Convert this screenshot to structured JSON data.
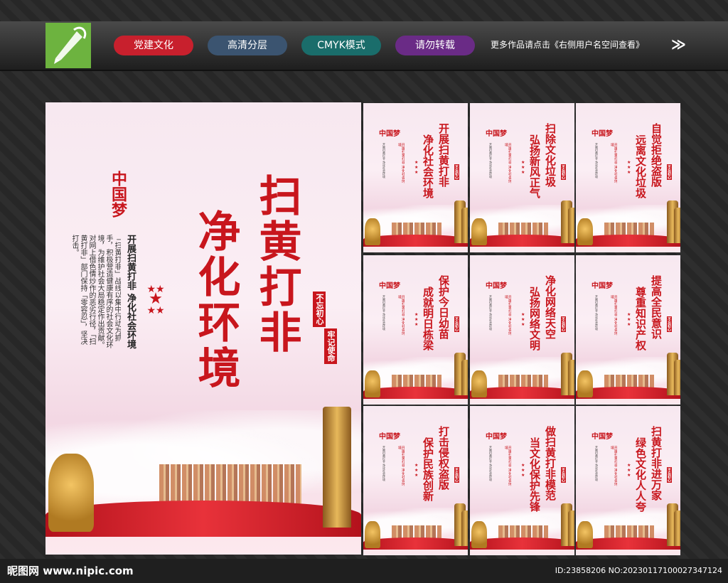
{
  "header": {
    "buttons": [
      {
        "label": "党建文化",
        "color": "#c8202d"
      },
      {
        "label": "高清分层",
        "color": "#3b5470"
      },
      {
        "label": "CMYK模式",
        "color": "#1a6d6b"
      },
      {
        "label": "请勿转载",
        "color": "#6a2b86"
      }
    ],
    "note": "更多作品请点击《右侧用户名空间查看》",
    "arrow": "≫"
  },
  "main_poster": {
    "title_a": "扫黄打非",
    "title_b": "净化环境",
    "subtitle": "开展扫黄打非 净化社会环境",
    "logo": "中国梦",
    "body": "「扫黄打非」战线以集中行动为抓手，积极营造健康有序的社会文化环境，为维护社会大局稳定作出贡献。对网上借色情炒作的恶劣行径，「扫黄打非」部门保持「零容忍」，坚决打击。",
    "slogan_a": "不忘初心",
    "slogan_b": "牢记使命"
  },
  "small_posters": [
    {
      "line1": "开展扫黄打非",
      "line2": "净化社会环境"
    },
    {
      "line1": "扫除文化垃圾",
      "line2": "弘扬新风正气"
    },
    {
      "line1": "自觉拒绝盗版",
      "line2": "远离文化垃圾"
    },
    {
      "line1": "保护今日幼苗",
      "line2": "成就明日栋梁"
    },
    {
      "line1": "净化网络天空",
      "line2": "弘扬网络文明"
    },
    {
      "line1": "提高全民意识",
      "line2": "尊重知识产权"
    },
    {
      "line1": "打击侵权盗版",
      "line2": "保护民族创新"
    },
    {
      "line1": "做扫黄打非模范",
      "line2": "当文化保护先锋"
    },
    {
      "line1": "扫黄打非进万家",
      "line2": "绿色文化人人夸"
    }
  ],
  "small_logo": "中国梦",
  "small_body": "开展扫黄打非 净化社会环境",
  "footer": {
    "site": "昵图网 www.nipic.com",
    "id": "ID:23858206 NO:20230117100027347124"
  }
}
